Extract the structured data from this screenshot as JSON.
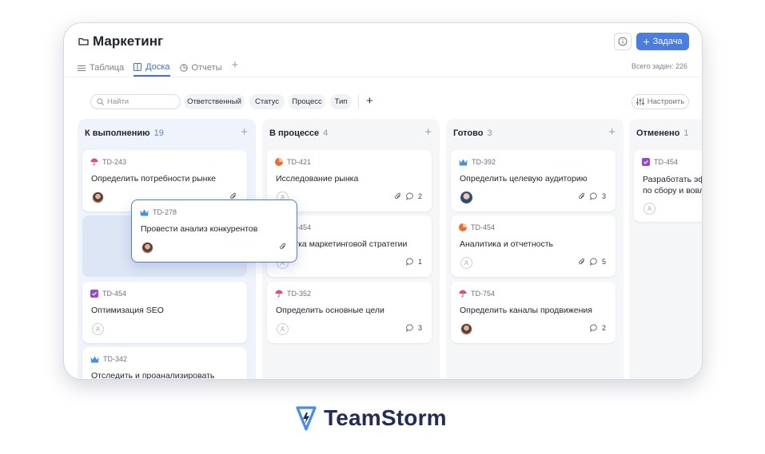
{
  "header": {
    "title": "Маркетинг",
    "add_task_label": "Задача",
    "total_tasks": "Всего задач: 226"
  },
  "tabs": [
    {
      "label": "Таблица",
      "icon": "list-icon"
    },
    {
      "label": "Доска",
      "icon": "board-icon",
      "active": true
    },
    {
      "label": "Отчеты",
      "icon": "pie-chart-icon"
    }
  ],
  "filters": {
    "search_placeholder": "Найти",
    "chips": [
      "Ответственный",
      "Статус",
      "Процесс",
      "Тип"
    ],
    "settings_label": "Настроить"
  },
  "columns": [
    {
      "title": "К выполнению",
      "count": "19"
    },
    {
      "title": "В процессе",
      "count": "4"
    },
    {
      "title": "Готово",
      "count": "3"
    },
    {
      "title": "Отменено",
      "count": "1"
    }
  ],
  "cards": {
    "todo": [
      {
        "id": "TD-243",
        "title": "Определить потребности рынке",
        "type": "umbrella"
      },
      {
        "id": "TD-454",
        "title": "Оптимизация SEO",
        "type": "check"
      },
      {
        "id": "TD-342",
        "title": "Отследить и проанализировать",
        "type": "crown"
      }
    ],
    "dragging": {
      "id": "TD-278",
      "title": "Провести анализ конкурентов",
      "type": "crown"
    },
    "progress": [
      {
        "id": "TD-421",
        "title": "Исследование рынка",
        "comments": "2",
        "type": "chart"
      },
      {
        "id": "TD-454",
        "title": "работка маркетинговой стратегии",
        "comments": "1",
        "type": "chart"
      },
      {
        "id": "TD-352",
        "title": "Определить основные цели",
        "comments": "3",
        "type": "umbrella"
      }
    ],
    "done": [
      {
        "id": "TD-392",
        "title": "Определить целевую аудиторию",
        "comments": "3",
        "type": "crown"
      },
      {
        "id": "TD-454",
        "title": "Аналитика и отчетность",
        "comments": "5",
        "type": "chart"
      },
      {
        "id": "TD-754",
        "title": "Определить каналы продвижения",
        "comments": "2",
        "type": "umbrella"
      }
    ],
    "cancelled": [
      {
        "id": "TD-454",
        "title_line1": "Разработать эф",
        "title_line2": "по сбору и вовл",
        "type": "check"
      }
    ]
  },
  "brand": {
    "name": "TeamStorm"
  },
  "colors": {
    "accent": "#4a7de2",
    "umbrella": "#e8457a",
    "chart": "#f26b2c",
    "crown": "#3d8ff0",
    "check": "#9a45d6",
    "brand": "#202c5a"
  }
}
